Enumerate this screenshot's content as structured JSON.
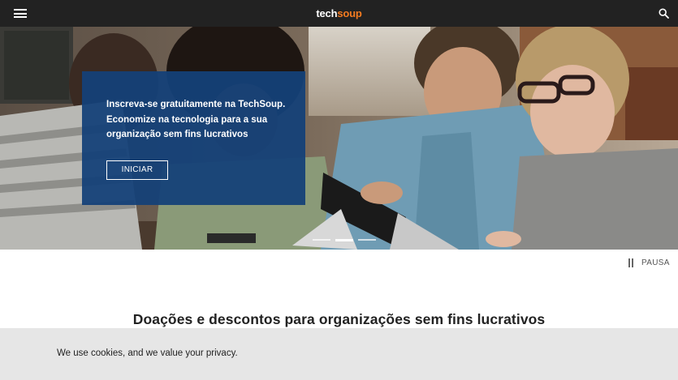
{
  "header": {
    "menu_icon": "hamburger-menu-icon",
    "logo_part1": "tech",
    "logo_part2": "soup",
    "logo_accent_color": "#f47b20",
    "search_icon": "search-icon"
  },
  "hero": {
    "promo_text": "Inscreva-se gratuitamente na TechSoup. Economize na tecnologia para a sua organização sem fins lucrativos",
    "cta_label": "INICIAR",
    "slide_count": 3,
    "active_slide": 2
  },
  "carousel": {
    "pause_label": "PAUSA"
  },
  "section": {
    "heading": "Doações e descontos para organizações sem fins lucrativos"
  },
  "cookie_banner": {
    "text": "We use cookies, and we value your privacy."
  },
  "colors": {
    "header_bg": "#222222",
    "promo_bg": "#144178",
    "cookie_bg": "#e6e6e6"
  }
}
